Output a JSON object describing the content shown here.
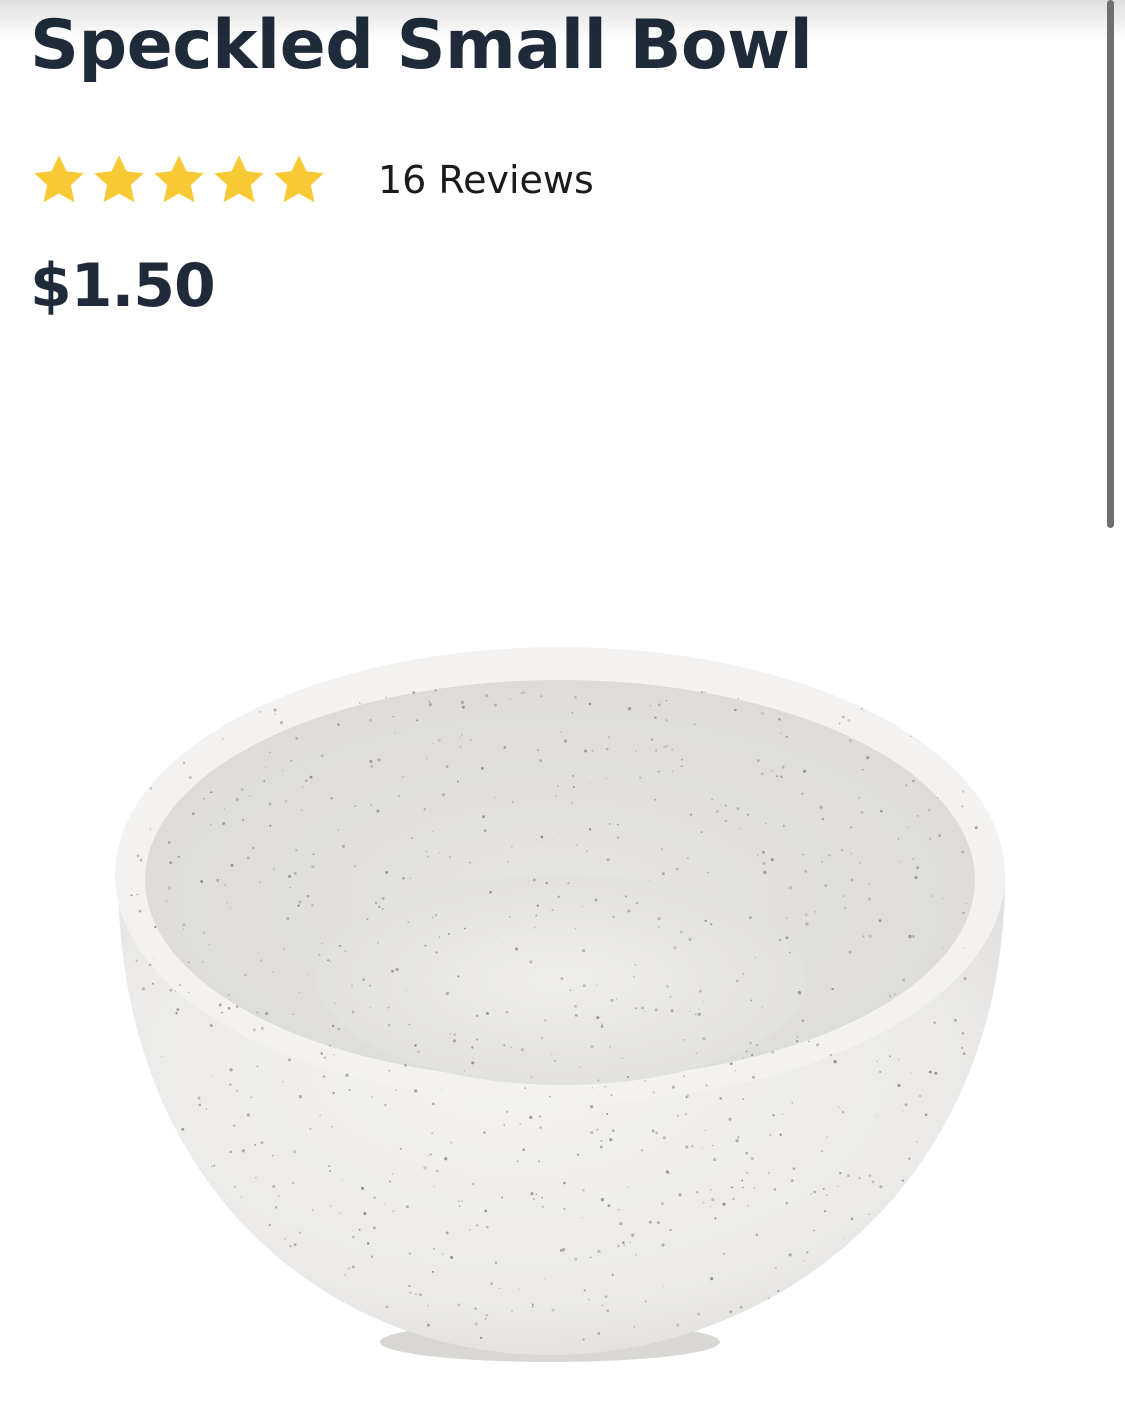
{
  "product": {
    "title": "Speckled Small Bowl",
    "rating": {
      "stars_filled": 5,
      "stars_total": 5,
      "review_count_label": "16 Reviews"
    },
    "price": "$1.50",
    "image": {
      "icon": "speckled-bowl-image"
    }
  },
  "colors": {
    "title_text": "#1f2b3a",
    "star": "#f7c934",
    "review_text": "#1b1b1b",
    "scrollbar": "#6f6f6f",
    "bowl_body": "#ecebe9",
    "bowl_inner": "#e3e2e0"
  }
}
